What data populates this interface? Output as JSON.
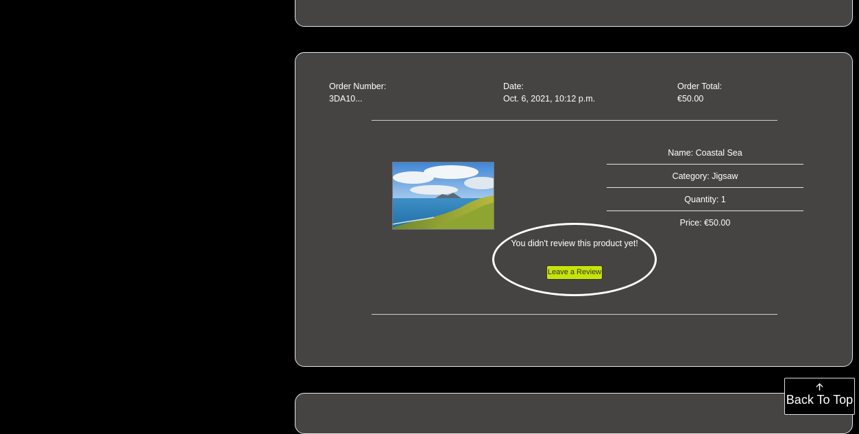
{
  "order": {
    "number_label": "Order Number:",
    "number_value": "3DA10...",
    "date_label": "Date:",
    "date_value": "Oct. 6, 2021, 10:12 p.m.",
    "total_label": "Order Total:",
    "total_value": "€50.00"
  },
  "product": {
    "image_icon": "coastal-sea-photo",
    "name": "Name: Coastal Sea",
    "category": "Category: Jigsaw",
    "quantity": "Quantity: 1",
    "price": "Price:  €50.00"
  },
  "review": {
    "message": "You didn't review this product yet!",
    "button_label": "Leave a Review",
    "button_color": "#c6e40a"
  },
  "back_to_top": {
    "arrow_icon": "arrow-up-icon",
    "arrow_glyph": "🡩",
    "label": "Back To Top"
  }
}
